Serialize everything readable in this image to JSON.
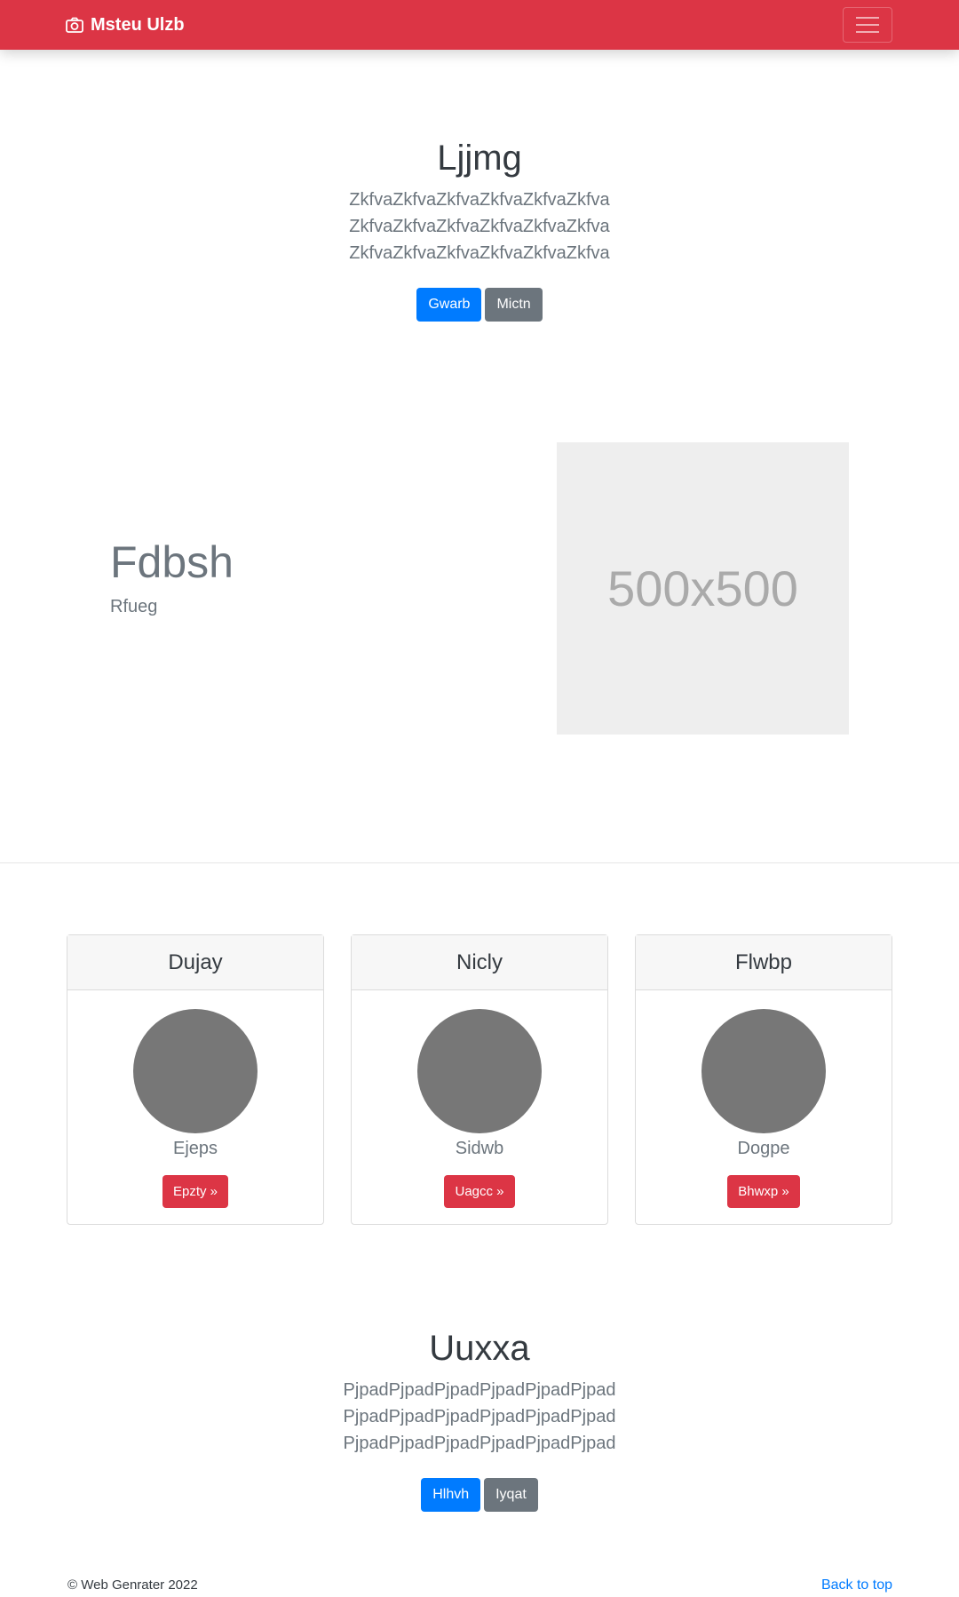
{
  "navbar": {
    "brand": "Msteu Ulzb",
    "brand_icon": "camera-icon",
    "toggler_icon": "hamburger-menu-icon",
    "color": "#dc3545"
  },
  "hero": {
    "title": "Ljjmg",
    "text": "ZkfvaZkfvaZkfvaZkfvaZkfvaZkfva ZkfvaZkfvaZkfvaZkfvaZkfvaZkfva ZkfvaZkfvaZkfvaZkfvaZkfvaZkfva",
    "primary_label": "Gwarb",
    "secondary_label": "Mictn"
  },
  "feature": {
    "title": "Fdbsh",
    "subtitle": "Rfueg",
    "image_label": "500x500"
  },
  "cards": [
    {
      "header": "Dujay",
      "text": "Ejeps",
      "button": "Epzty »"
    },
    {
      "header": "Nicly",
      "text": "Sidwb",
      "button": "Uagcc »"
    },
    {
      "header": "Flwbp",
      "text": "Dogpe",
      "button": "Bhwxp »"
    }
  ],
  "cta": {
    "title": "Uuxxa",
    "text": "PjpadPjpadPjpadPjpadPjpadPjpad PjpadPjpadPjpadPjpadPjpadPjpad PjpadPjpadPjpadPjpadPjpadPjpad",
    "primary_label": "Hlhvh",
    "secondary_label": "Iyqat"
  },
  "footer": {
    "copyright": "© Web Genrater 2022",
    "back_to_top": "Back to top"
  },
  "colors": {
    "primary": "#007bff",
    "secondary": "#6c757d",
    "danger": "#dc3545"
  }
}
